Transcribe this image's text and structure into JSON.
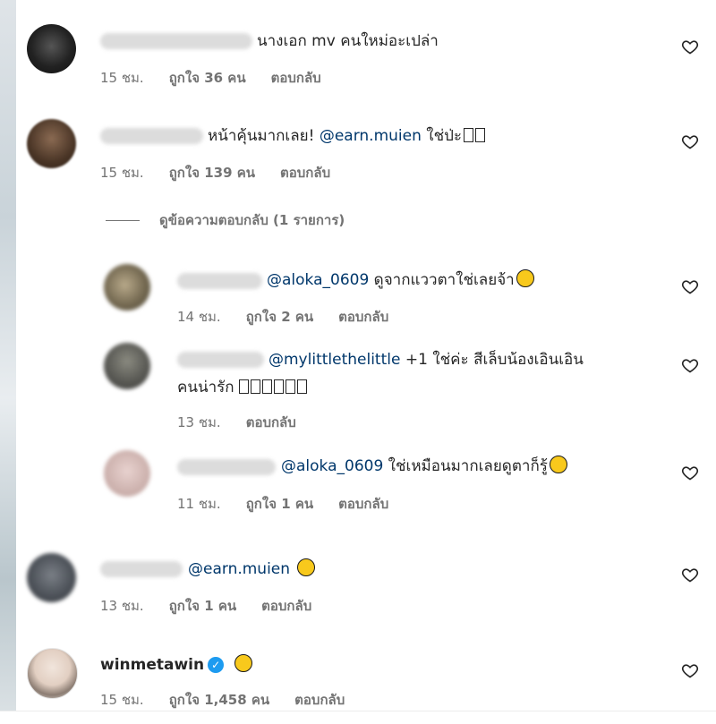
{
  "comments": [
    {
      "text": "นางเอก mv คนใหม่อะเปล่า",
      "time": "15 ชม.",
      "likes": "ถูกใจ 36 คน",
      "reply": "ตอบกลับ"
    },
    {
      "text_a": "หน้าคุ้นมากเลย! ",
      "mention": "@earn.muien",
      "text_b": " ใช่ป่ะ",
      "time": "15 ชม.",
      "likes": "ถูกใจ 139 คน",
      "reply": "ตอบกลับ"
    },
    {
      "mention": "@earn.muien",
      "time": "13 ชม.",
      "likes": "ถูกใจ 1 คน",
      "reply": "ตอบกลับ"
    },
    {
      "username": "winmetawin",
      "time": "15 ชม.",
      "likes": "ถูกใจ 1,458 คน",
      "reply": "ตอบกลับ"
    }
  ],
  "view_replies": "ดูข้อความตอบกลับ (1 รายการ)",
  "replies": [
    {
      "mention": "@aloka_0609",
      "text": " ดูจากแววตาใช่เลยจ้า",
      "time": "14 ชม.",
      "likes": "ถูกใจ 2 คน",
      "reply": "ตอบกลับ"
    },
    {
      "mention": "@mylittlethelittle",
      "text_line1": " +1 ใช่ค่ะ สีเล็บน้องเอินเอิน",
      "text_line2": "คนน่ารัก ",
      "time": "13 ชม.",
      "reply": "ตอบกลับ"
    },
    {
      "mention": "@aloka_0609",
      "text": " ใช่เหมือนมากเลยดูตาก็รู้",
      "time": "11 ชม.",
      "likes": "ถูกใจ 1 คน",
      "reply": "ตอบกลับ"
    }
  ],
  "icons": {
    "like": "heart-icon",
    "verified": "verified-badge-icon"
  },
  "colors": {
    "mention": "#00376b",
    "meta": "#737373",
    "verified": "#1d9bf0"
  }
}
